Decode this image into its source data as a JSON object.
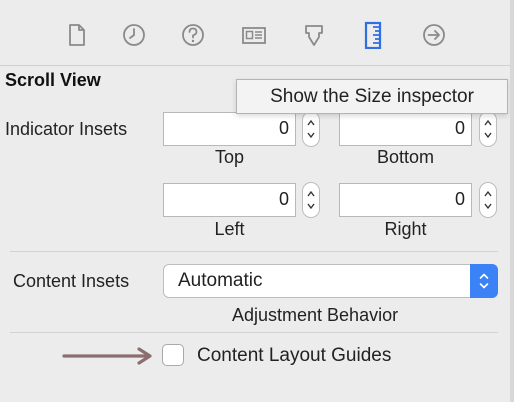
{
  "toolbar": {
    "icons": [
      {
        "name": "file-inspector-icon"
      },
      {
        "name": "history-inspector-icon"
      },
      {
        "name": "quick-help-icon"
      },
      {
        "name": "identity-inspector-icon"
      },
      {
        "name": "attributes-inspector-icon"
      },
      {
        "name": "size-inspector-icon",
        "selected": true
      },
      {
        "name": "connections-inspector-icon"
      }
    ],
    "selected_color": "#2f6fe0",
    "icon_color": "#8a8a8a"
  },
  "tooltip": {
    "text": "Show the Size inspector"
  },
  "scroll_view": {
    "title": "Scroll View",
    "indicator_insets": {
      "label": "Indicator Insets",
      "top": {
        "value": "0",
        "label": "Top"
      },
      "bottom": {
        "value": "0",
        "label": "Bottom"
      },
      "left": {
        "value": "0",
        "label": "Left"
      },
      "right": {
        "value": "0",
        "label": "Right"
      }
    },
    "content_insets": {
      "label": "Content Insets",
      "value": "Automatic",
      "caption": "Adjustment Behavior"
    },
    "content_layout_guides": {
      "label": "Content Layout Guides",
      "checked": false
    }
  },
  "annotation": {
    "arrow_color": "#8b6f6f"
  }
}
